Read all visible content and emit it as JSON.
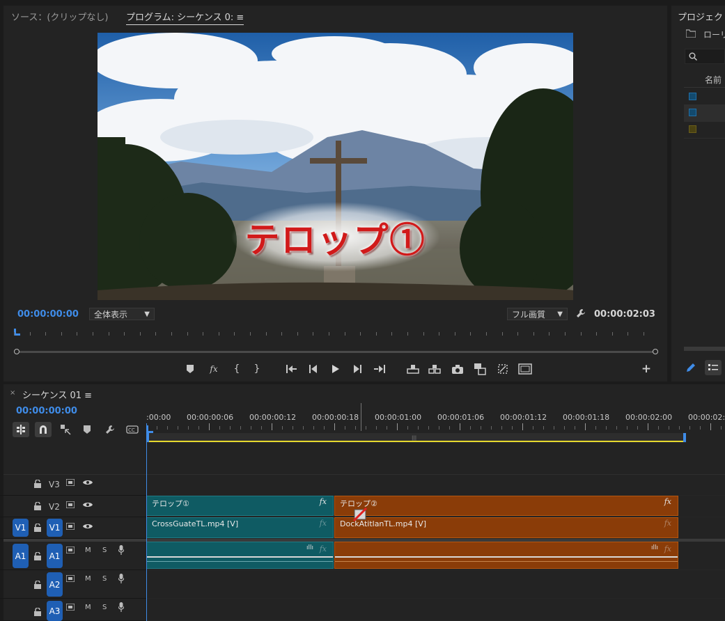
{
  "source_tab": "ソース：(クリップなし)",
  "program_tab": "プログラム: シーケンス 0: ≡",
  "project_tab": "プロジェクト",
  "project": {
    "bin": "ローリ",
    "name_header": "名前",
    "item_colors": [
      "#1f6fa8",
      "#1f6fa8",
      "#6b5e1a"
    ]
  },
  "program": {
    "timecode_current": "00:00:00:00",
    "fit_select": "全体表示",
    "quality_select": "フル画質",
    "timecode_duration": "00:00:02:03",
    "overlay_title": "テロップ①"
  },
  "sequence": {
    "tab_title": "シーケンス 01 ≡",
    "timecode": "00:00:00:00",
    "ruler": [
      ":00:00",
      "00:00:00:06",
      "00:00:00:12",
      "00:00:00:18",
      "00:00:01:00",
      "00:00:01:06",
      "00:00:01:12",
      "00:00:01:18",
      "00:00:02:00",
      "00:00:02:"
    ],
    "tracks": {
      "v3": "V3",
      "v2": "V2",
      "v1": "V1",
      "v1_src": "V1",
      "a1": "A1",
      "a1_src": "A1",
      "a2": "A2",
      "a3": "A3",
      "m": "M",
      "s": "S"
    },
    "clips": {
      "v2_a": "テロップ①",
      "v2_b": "テロップ②",
      "v1_a": "CrossGuateTL.mp4 [V]",
      "v1_b": "DockAtitlanTL.mp4 [V]",
      "fx": "fx"
    }
  },
  "colors": {
    "accent": "#3f8ce8",
    "teal": "#0f5b63",
    "orange": "#8a3c08",
    "track_btn": "#1f5fb4"
  }
}
